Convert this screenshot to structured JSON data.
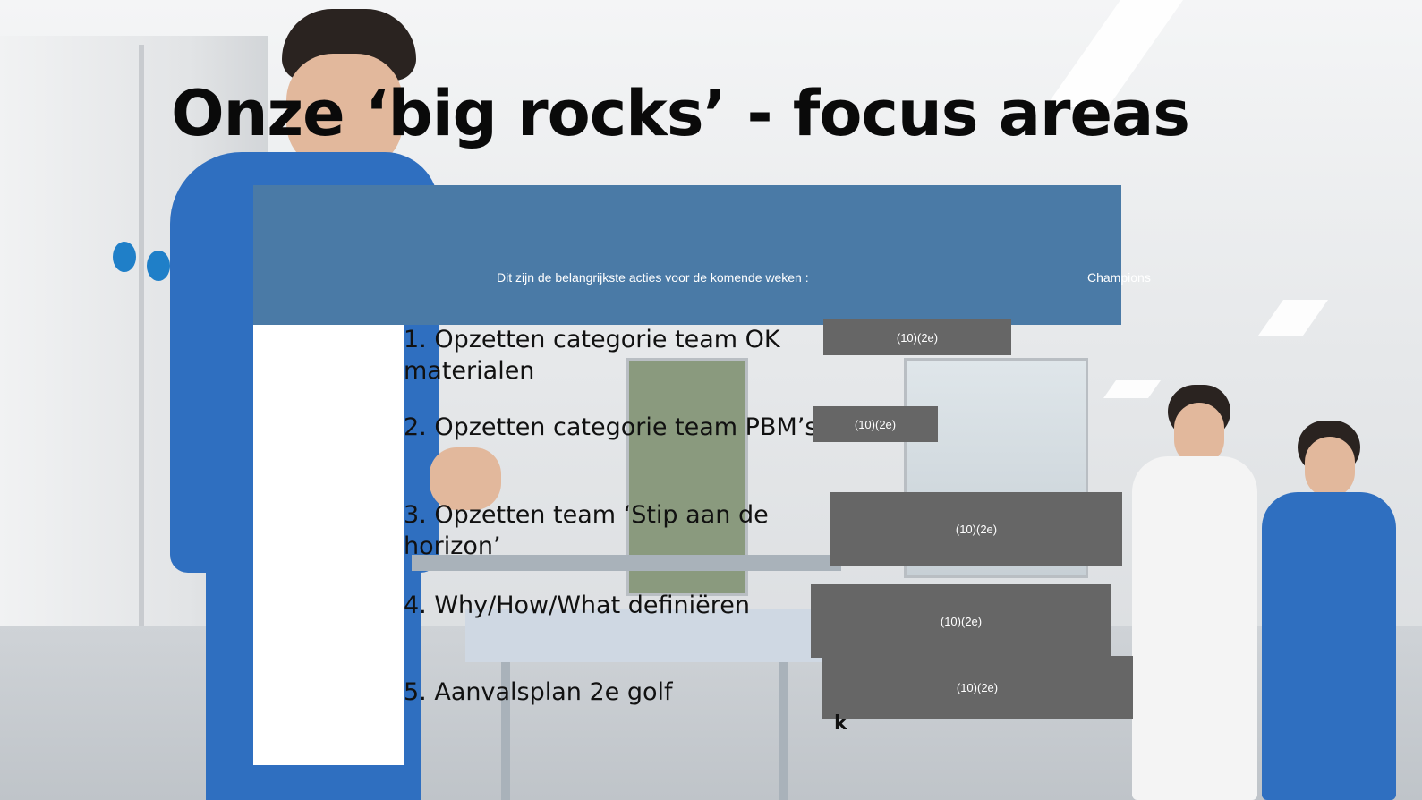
{
  "slide": {
    "title": "Onze ‘big rocks’ - focus areas",
    "header_text": "Dit zijn de belangrijkste acties voor de komende weken :",
    "header_champions": "Champions",
    "actions": [
      {
        "label_line1": "1. Opzetten categorie team OK",
        "label_line2": "materialen",
        "badge": "(10)(2e)"
      },
      {
        "label_line1": "2. Opzetten categorie team PBM’s",
        "label_line2": "",
        "badge": "(10)(2e)"
      },
      {
        "label_line1": "3. Opzetten team ‘Stip aan de",
        "label_line2": "horizon’",
        "badge": "(10)(2e)"
      },
      {
        "label_line1": "4. Why/How/What definiëren",
        "label_line2": "",
        "badge": "(10)(2e)"
      },
      {
        "label_line1": "5. Aanvalsplan 2e golf",
        "label_line2": "",
        "badge": "(10)(2e)"
      }
    ],
    "stray_text": "k"
  },
  "colors": {
    "header_blue": "#4a7aa6",
    "badge_grey": "#666666",
    "scrubs_blue": "#2f6fc0"
  }
}
